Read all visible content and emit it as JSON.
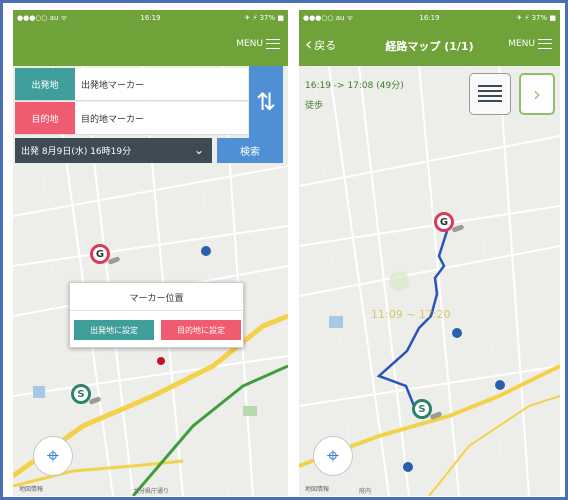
{
  "left_screen": {
    "status": {
      "carrier": "●●●○○ au ᯤ",
      "time": "16:19",
      "battery": "✈ ⚡ 37% ■"
    },
    "menu_label": "MENU",
    "origin": {
      "label": "出発地",
      "value": "出発地マーカー"
    },
    "destination": {
      "label": "目的地",
      "value": "目的地マーカー"
    },
    "datetime": {
      "text": "出発 8月9日(水) 16時19分"
    },
    "search_label": "検索",
    "popup": {
      "title": "マーカー位置",
      "set_origin_label": "出発地に設定",
      "set_destination_label": "目的地に設定"
    },
    "goal_pin_label": "G",
    "start_pin_label": "S",
    "map_labels": {
      "bottom": "大分県庁通り",
      "corner": "地図情報"
    }
  },
  "right_screen": {
    "status": {
      "carrier": "●●●○○ au ᯤ",
      "time": "16:19",
      "battery": "✈ ⚡ 37% ■"
    },
    "back_label": "戻る",
    "title": "経路マップ (1/1)",
    "menu_label": "MENU",
    "route_time": "16:19 -> 17:08 (49分)",
    "route_mode": "徒歩",
    "overlay_time": "11:09 ~ 17:20",
    "goal_pin_label": "G",
    "start_pin_label": "S",
    "map_labels": {
      "corner": "地図情報",
      "bottom": "府内"
    }
  },
  "colors": {
    "header_green": "#6fa33a",
    "origin_teal": "#3f9e9a",
    "destination_pink": "#ef5b71",
    "action_blue": "#4f8fd3",
    "route_blue": "#2a55b8"
  }
}
